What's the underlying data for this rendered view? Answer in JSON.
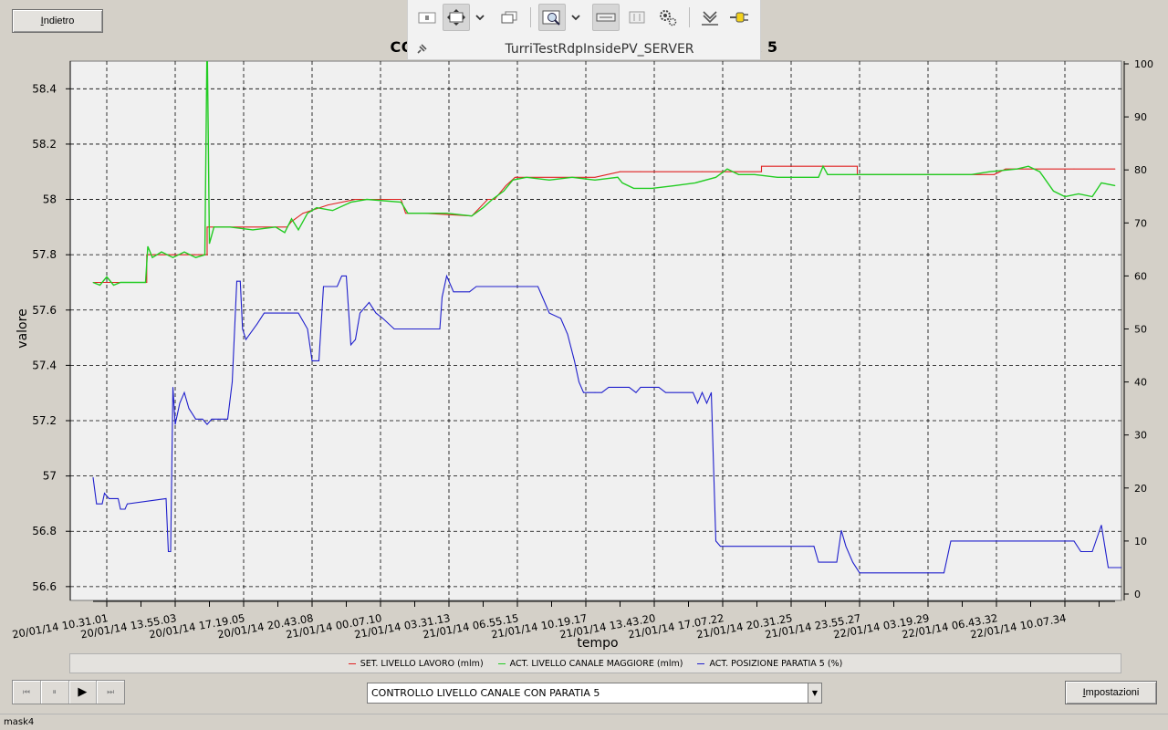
{
  "toolbar": {
    "back_label": "Indietro",
    "settings_label": "Impostazioni"
  },
  "page_title": "CONTROLLO LIVELLO CANALE CON PARATIA 5",
  "rdp": {
    "connection_name": "TurriTestRdpInsidePV_SERVER"
  },
  "playback": {
    "first": "⏮",
    "pause": "⏸",
    "play": "▶",
    "last": "⏭"
  },
  "selector": {
    "value": "CONTROLLO LIVELLO CANALE CON PARATIA 5"
  },
  "status_text": "mask4",
  "chart_data": {
    "type": "line",
    "xlabel": "tempo",
    "ylabel": "valore",
    "ylim": [
      56.55,
      58.5
    ],
    "ylim_right": [
      0,
      100
    ],
    "y_ticks": [
      "56.6",
      "56.8",
      "57",
      "57.2",
      "57.4",
      "57.6",
      "57.8",
      "58",
      "58.2",
      "58.4"
    ],
    "y2_ticks": [
      "0",
      "10",
      "20",
      "30",
      "40",
      "50",
      "60",
      "70",
      "80",
      "90",
      "100"
    ],
    "x_ticks": [
      "20/01/14 10.31.01",
      "20/01/14 13.55.03",
      "20/01/14 17.19.05",
      "20/01/14 20.43.08",
      "21/01/14 00.07.10",
      "21/01/14 03.31.13",
      "21/01/14 06.55.15",
      "21/01/14 10.19.17",
      "21/01/14 13.43.20",
      "21/01/14 17.07.22",
      "21/01/14 20.31.25",
      "21/01/14 23.55.27",
      "22/01/14 03.19.29",
      "22/01/14 06.43.32",
      "22/01/14 10.07.34"
    ],
    "grid": true,
    "legend_position": "bottom",
    "series": [
      {
        "name": "SET. LIVELLO LAVORO (mlm)",
        "color": "#e02020",
        "axis": "left",
        "points": [
          [
            0,
            57.7
          ],
          [
            0.8,
            57.7
          ],
          [
            2.35,
            57.7
          ],
          [
            2.35,
            57.8
          ],
          [
            5,
            57.8
          ],
          [
            5,
            57.9
          ],
          [
            8.5,
            57.9
          ],
          [
            8.7,
            57.92
          ],
          [
            9.2,
            57.95
          ],
          [
            10.3,
            57.98
          ],
          [
            11.5,
            58.0
          ],
          [
            13.5,
            58.0
          ],
          [
            13.7,
            57.95
          ],
          [
            14.5,
            57.95
          ],
          [
            16.6,
            57.94
          ],
          [
            17.3,
            58.0
          ],
          [
            17.6,
            58.0
          ],
          [
            18.1,
            58.05
          ],
          [
            18.5,
            58.08
          ],
          [
            22,
            58.08
          ],
          [
            23.1,
            58.1
          ],
          [
            24,
            58.1
          ],
          [
            26.7,
            58.1
          ],
          [
            29.3,
            58.1
          ],
          [
            29.3,
            58.12
          ],
          [
            33.5,
            58.12
          ],
          [
            33.5,
            58.09
          ],
          [
            35,
            58.09
          ],
          [
            38,
            58.09
          ],
          [
            39.5,
            58.09
          ],
          [
            40,
            58.11
          ],
          [
            43,
            58.11
          ],
          [
            44.8,
            58.11
          ]
        ]
      },
      {
        "name": "ACT. LIVELLO CANALE MAGGIORE (mlm)",
        "color": "#22cc22",
        "axis": "left",
        "points": [
          [
            0,
            57.7
          ],
          [
            0.3,
            57.69
          ],
          [
            0.6,
            57.72
          ],
          [
            0.9,
            57.69
          ],
          [
            1.2,
            57.7
          ],
          [
            2.3,
            57.7
          ],
          [
            2.4,
            57.83
          ],
          [
            2.6,
            57.79
          ],
          [
            3,
            57.81
          ],
          [
            3.5,
            57.79
          ],
          [
            4,
            57.81
          ],
          [
            4.5,
            57.79
          ],
          [
            4.9,
            57.8
          ],
          [
            5,
            58.6
          ],
          [
            5.1,
            57.84
          ],
          [
            5.3,
            57.9
          ],
          [
            6,
            57.9
          ],
          [
            7,
            57.89
          ],
          [
            8,
            57.9
          ],
          [
            8.4,
            57.88
          ],
          [
            8.7,
            57.93
          ],
          [
            9,
            57.89
          ],
          [
            9.4,
            57.95
          ],
          [
            9.8,
            57.97
          ],
          [
            10.5,
            57.96
          ],
          [
            11.3,
            57.99
          ],
          [
            12,
            58.0
          ],
          [
            13.5,
            57.99
          ],
          [
            13.8,
            57.95
          ],
          [
            14.5,
            57.95
          ],
          [
            15.5,
            57.95
          ],
          [
            16.6,
            57.94
          ],
          [
            17.1,
            57.97
          ],
          [
            17.5,
            58.0
          ],
          [
            18,
            58.03
          ],
          [
            18.4,
            58.07
          ],
          [
            19,
            58.08
          ],
          [
            20,
            58.07
          ],
          [
            21,
            58.08
          ],
          [
            22,
            58.07
          ],
          [
            23,
            58.08
          ],
          [
            23.2,
            58.06
          ],
          [
            23.7,
            58.04
          ],
          [
            24.5,
            58.04
          ],
          [
            25.5,
            58.05
          ],
          [
            26.4,
            58.06
          ],
          [
            27.3,
            58.08
          ],
          [
            27.8,
            58.11
          ],
          [
            28.3,
            58.09
          ],
          [
            29,
            58.09
          ],
          [
            30,
            58.08
          ],
          [
            31,
            58.08
          ],
          [
            31.8,
            58.08
          ],
          [
            32,
            58.12
          ],
          [
            32.2,
            58.09
          ],
          [
            33,
            58.09
          ],
          [
            35,
            58.09
          ],
          [
            37,
            58.09
          ],
          [
            38.5,
            58.09
          ],
          [
            39.3,
            58.1
          ],
          [
            40.5,
            58.11
          ],
          [
            41,
            58.12
          ],
          [
            41.5,
            58.1
          ],
          [
            42.1,
            58.03
          ],
          [
            42.6,
            58.01
          ],
          [
            43.2,
            58.02
          ],
          [
            43.8,
            58.01
          ],
          [
            44.2,
            58.06
          ],
          [
            44.8,
            58.05
          ]
        ]
      },
      {
        "name": "ACT. POSIZIONE PARATIA 5 (%)",
        "color": "#1f1fcc",
        "axis": "right",
        "points": [
          [
            0,
            22
          ],
          [
            0.15,
            17
          ],
          [
            0.4,
            17
          ],
          [
            0.5,
            19
          ],
          [
            0.7,
            18
          ],
          [
            1.1,
            18
          ],
          [
            1.2,
            16
          ],
          [
            1.4,
            16
          ],
          [
            1.5,
            17
          ],
          [
            3.2,
            18
          ],
          [
            3.3,
            8
          ],
          [
            3.4,
            8
          ],
          [
            3.5,
            39
          ],
          [
            3.6,
            32
          ],
          [
            3.8,
            36
          ],
          [
            4,
            38
          ],
          [
            4.2,
            35
          ],
          [
            4.5,
            33
          ],
          [
            4.8,
            33
          ],
          [
            5,
            32
          ],
          [
            5.2,
            33
          ],
          [
            5.5,
            33
          ],
          [
            5.9,
            33
          ],
          [
            6.1,
            40
          ],
          [
            6.3,
            59
          ],
          [
            6.45,
            59
          ],
          [
            6.55,
            50
          ],
          [
            6.7,
            48
          ],
          [
            7.2,
            51
          ],
          [
            7.5,
            53
          ],
          [
            9,
            53
          ],
          [
            9.4,
            50
          ],
          [
            9.6,
            44
          ],
          [
            9.9,
            44
          ],
          [
            10.1,
            58
          ],
          [
            10.4,
            58
          ],
          [
            10.7,
            58
          ],
          [
            10.9,
            60
          ],
          [
            11.1,
            60
          ],
          [
            11.3,
            47
          ],
          [
            11.5,
            48
          ],
          [
            11.7,
            53
          ],
          [
            12.1,
            55
          ],
          [
            12.4,
            53
          ],
          [
            12.7,
            52
          ],
          [
            13.2,
            50
          ],
          [
            13.5,
            50
          ],
          [
            14,
            50
          ],
          [
            15.2,
            50
          ],
          [
            15.3,
            56
          ],
          [
            15.5,
            60
          ],
          [
            15.8,
            57
          ],
          [
            16.5,
            57
          ],
          [
            16.8,
            58
          ],
          [
            19.5,
            58
          ],
          [
            19.7,
            56
          ],
          [
            20,
            53
          ],
          [
            20.5,
            52
          ],
          [
            20.8,
            49
          ],
          [
            21.1,
            44
          ],
          [
            21.3,
            40
          ],
          [
            21.5,
            38
          ],
          [
            22,
            38
          ],
          [
            22.3,
            38
          ],
          [
            22.6,
            39
          ],
          [
            23.5,
            39
          ],
          [
            23.8,
            38
          ],
          [
            24,
            39
          ],
          [
            24.8,
            39
          ],
          [
            25.1,
            38
          ],
          [
            26.3,
            38
          ],
          [
            26.5,
            36
          ],
          [
            26.7,
            38
          ],
          [
            26.9,
            36
          ],
          [
            27.1,
            38
          ],
          [
            27.3,
            10
          ],
          [
            27.5,
            9
          ],
          [
            31.4,
            9
          ],
          [
            31.6,
            9
          ],
          [
            31.8,
            6
          ],
          [
            32.6,
            6
          ],
          [
            32.8,
            12
          ],
          [
            33,
            9
          ],
          [
            33.3,
            6
          ],
          [
            33.6,
            4
          ],
          [
            36.6,
            4
          ],
          [
            37.3,
            4
          ],
          [
            37.6,
            10
          ],
          [
            37.9,
            10
          ],
          [
            38.3,
            10
          ],
          [
            43,
            10
          ],
          [
            43.3,
            8
          ],
          [
            43.8,
            8
          ],
          [
            44.2,
            13
          ],
          [
            44.5,
            5
          ],
          [
            48,
            5
          ]
        ]
      }
    ]
  }
}
